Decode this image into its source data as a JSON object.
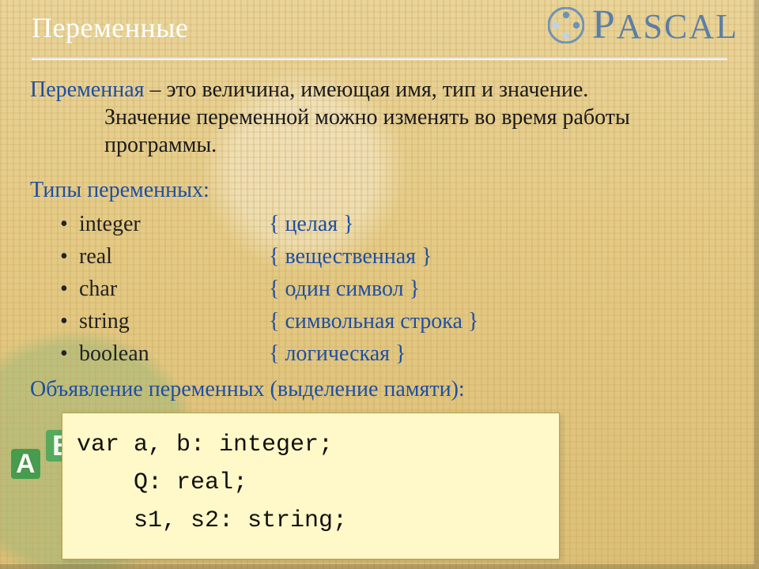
{
  "header": {
    "title": "Переменные",
    "brand": "Pascal"
  },
  "definition": {
    "term": "Переменная",
    "dash_and_first": " – это величина, имеющая имя, тип и значение.",
    "rest": "Значение переменной можно изменять во время работы программы."
  },
  "types": {
    "heading": "Типы переменных:",
    "items": [
      {
        "name": "integer",
        "note": "{ целая }"
      },
      {
        "name": "real",
        "note": "{ вещественная }"
      },
      {
        "name": "char",
        "note": "{ один символ }"
      },
      {
        "name": "string",
        "note": "{ символьная строка }"
      },
      {
        "name": "boolean",
        "note": "{ логическая }"
      }
    ]
  },
  "declaration": {
    "heading": "Объявление переменных (выделение памяти):",
    "code": "var a, b: integer;\n    Q: real;\n    s1, s2: string;"
  },
  "decor": {
    "letter_a": "А",
    "letter_b": "В"
  }
}
